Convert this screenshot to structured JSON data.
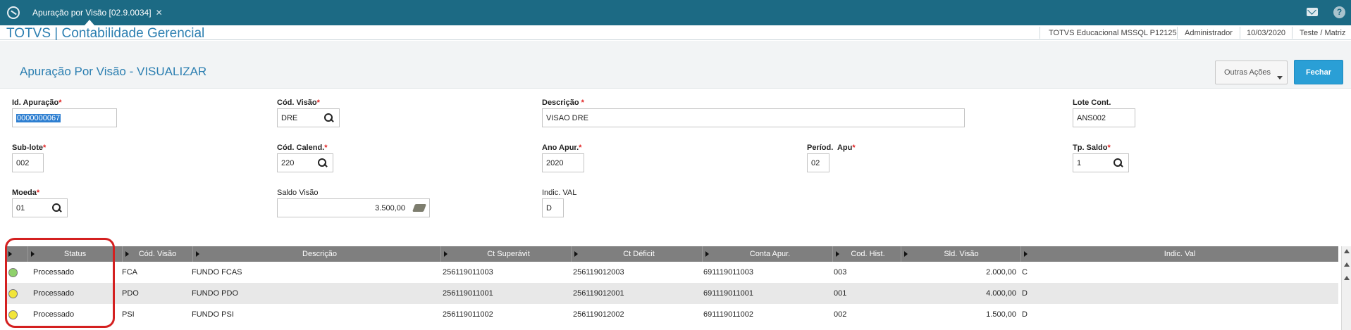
{
  "topbar": {
    "tab_label": "Apuração por Visão [02.9.0034]",
    "tab_close": "✕",
    "help_label": "?"
  },
  "header": {
    "app_title": "TOTVS | Contabilidade Gerencial",
    "environment": "TOTVS Educacional MSSQL P12125",
    "user": "Administrador",
    "date": "10/03/2020",
    "branch": "Teste / Matriz"
  },
  "page": {
    "title": "Apuração Por Visão - VISUALIZAR",
    "outras_acoes_label": "Outras Ações",
    "fechar_label": "Fechar"
  },
  "form": {
    "id_apuracao": {
      "label": "Id. Apuração",
      "value": "0000000067"
    },
    "cod_visao": {
      "label": "Cód. Visão",
      "value": "DRE"
    },
    "descricao": {
      "label": "Descrição",
      "value": "VISAO DRE"
    },
    "lote_cont": {
      "label": "Lote Cont.",
      "value": "ANS002"
    },
    "sub_lote": {
      "label": "Sub-lote",
      "value": "002"
    },
    "cod_calend": {
      "label": "Cód. Calend.",
      "value": "220"
    },
    "ano_apur": {
      "label": "Ano Apur.",
      "value": "2020"
    },
    "period_apu": {
      "label": "Períod.  Apu",
      "value": "02"
    },
    "tp_saldo": {
      "label": "Tp. Saldo",
      "value": "1"
    },
    "moeda": {
      "label": "Moeda",
      "value": "01"
    },
    "saldo_visao": {
      "label": "Saldo Visão",
      "value": "3.500,00"
    },
    "indic_val": {
      "label": "Indic. VAL",
      "value": "D"
    },
    "required_mark": "*"
  },
  "grid": {
    "headers": [
      "Status",
      "Cód. Visão",
      "Descrição",
      "Ct Superávit",
      "Ct Déficit",
      "Conta Apur.",
      "Cod. Hist.",
      "Sld. Visão",
      "Indic. Val"
    ],
    "rows": [
      {
        "status_color": "#8fd16b",
        "status": "Processado",
        "cod_visao": "FCA",
        "descricao": "FUNDO FCAS",
        "ct_superavit": "256119011003",
        "ct_deficit": "256119012003",
        "conta_apur": "691119011003",
        "cod_hist": "003",
        "sld_visao": "2.000,00",
        "indic_val": "C"
      },
      {
        "status_color": "#f2e53a",
        "status": "Processado",
        "cod_visao": "PDO",
        "descricao": "FUNDO PDO",
        "ct_superavit": "256119011001",
        "ct_deficit": "256119012001",
        "conta_apur": "691119011001",
        "cod_hist": "001",
        "sld_visao": "4.000,00",
        "indic_val": "D"
      },
      {
        "status_color": "#f2e53a",
        "status": "Processado",
        "cod_visao": "PSI",
        "descricao": "FUNDO PSI",
        "ct_superavit": "256119011002",
        "ct_deficit": "256119012002",
        "conta_apur": "691119011002",
        "cod_hist": "002",
        "sld_visao": "1.500,00",
        "indic_val": "D"
      }
    ]
  }
}
